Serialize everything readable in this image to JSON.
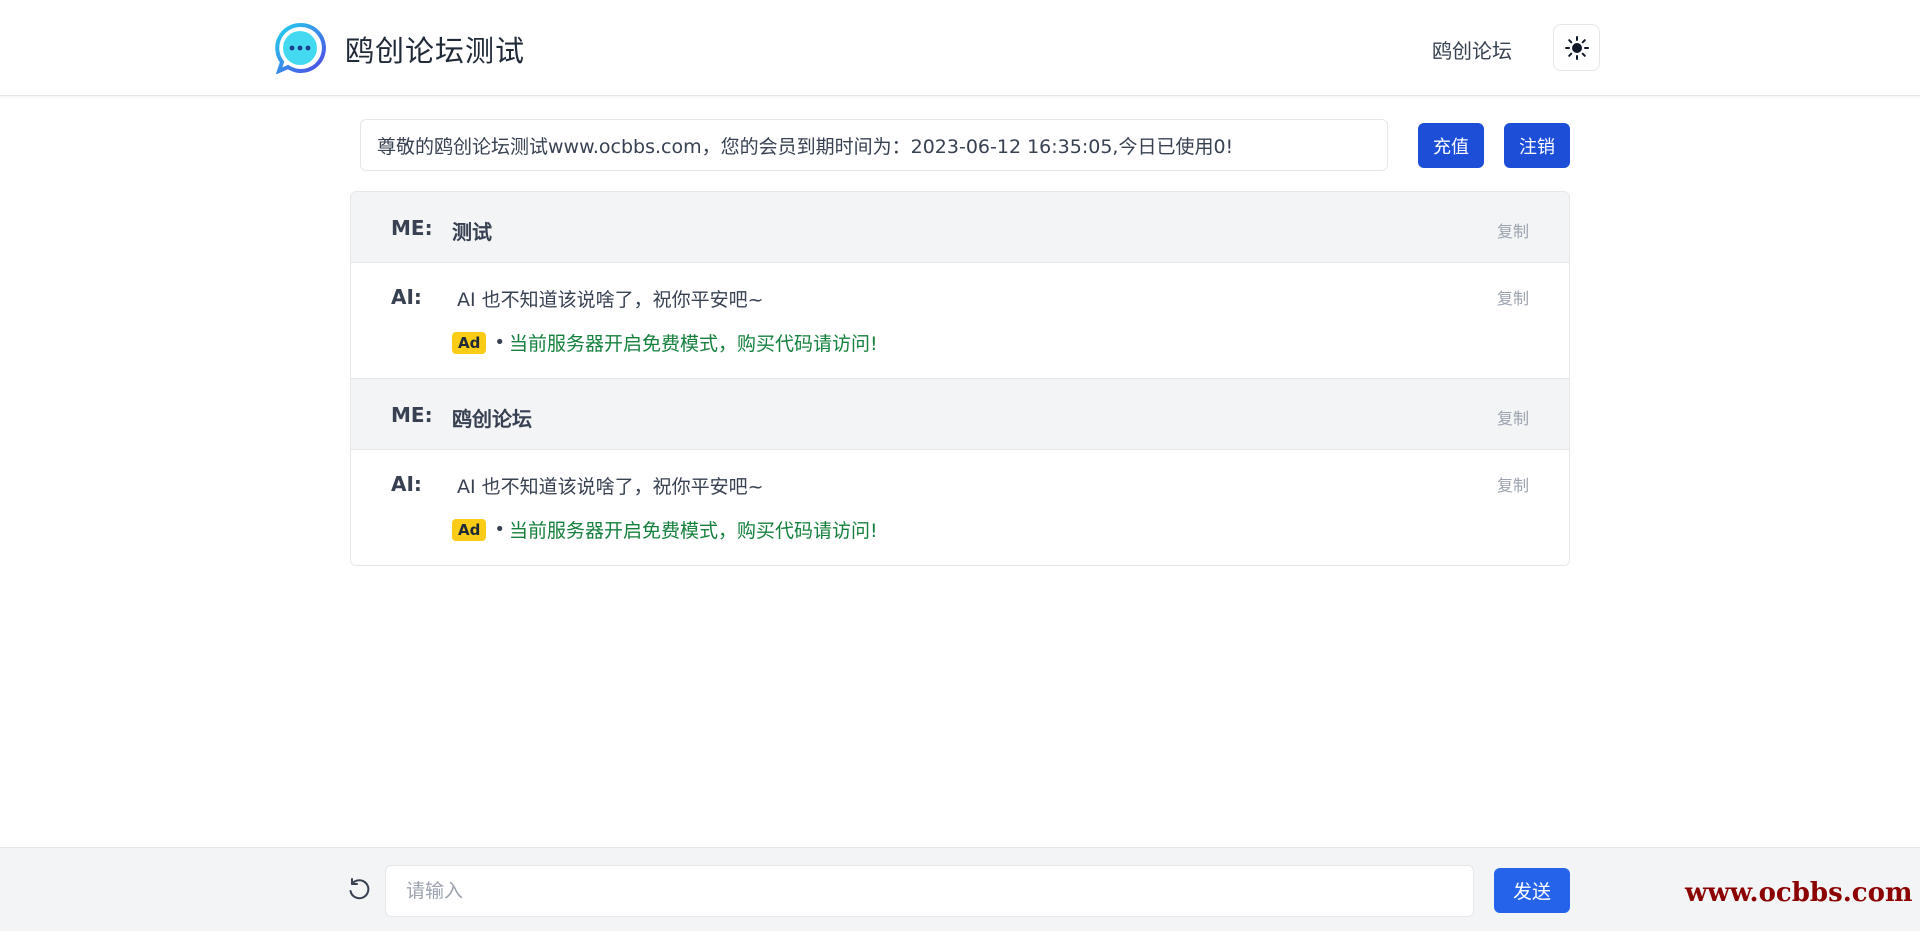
{
  "header": {
    "site_title": "鸥创论坛测试",
    "nav_link": "鸥创论坛",
    "theme_icon": "sun-icon",
    "logo_icon": "chat-bubble-icon"
  },
  "notice": {
    "text": "尊敬的鸥创论坛测试www.ocbbs.com，您的会员到期时间为：2023-06-12 16:35:05,今日已使用0!",
    "recharge_label": "充值",
    "logout_label": "注销"
  },
  "messages": [
    {
      "role": "ME:",
      "text": "测试",
      "copy_label": "复制"
    },
    {
      "role": "AI:",
      "text": "AI 也不知道该说啥了，祝你平安吧~",
      "copy_label": "复制",
      "ad_badge": "Ad",
      "ad_dot": "•",
      "ad_text": "当前服务器开启免费模式，购买代码请访问!"
    },
    {
      "role": "ME:",
      "text": "鸥创论坛",
      "copy_label": "复制"
    },
    {
      "role": "AI:",
      "text": "AI 也不知道该说啥了，祝你平安吧~",
      "copy_label": "复制",
      "ad_badge": "Ad",
      "ad_dot": "•",
      "ad_text": "当前服务器开启免费模式，购买代码请访问!"
    }
  ],
  "composer": {
    "placeholder": "请输入",
    "value": "",
    "send_label": "发送",
    "refresh_icon": "refresh-icon"
  },
  "watermark": "www.ocbbs.com",
  "colors": {
    "primary": "#1d4ed8",
    "send": "#2563eb",
    "ad_badge": "#facc15",
    "ad_text": "#15803d",
    "watermark": "#8b0000"
  }
}
